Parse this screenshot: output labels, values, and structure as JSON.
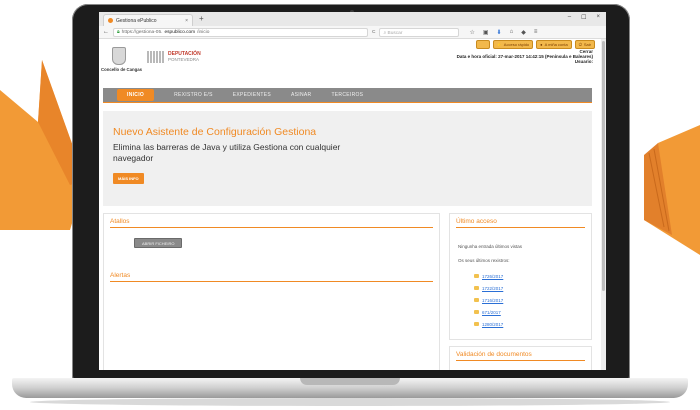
{
  "colors": {
    "accent": "#f08a24",
    "navbar": "#8a8a8a",
    "link": "#2a6fd6",
    "banner_bg": "#f0f0f0"
  },
  "browser": {
    "tab_title": "Gestiona ePublico",
    "tab_close": "×",
    "new_tab": "+",
    "window_controls": [
      "–",
      "☐",
      "×"
    ],
    "url_prefix": "https://gestiona-05.",
    "url_domain": "espublico.com",
    "url_path": "/inicio",
    "search_placeholder": "Buscar",
    "toolbar_icons": [
      "star-icon",
      "bookmark-icon",
      "download-icon",
      "home-icon",
      "shield-icon",
      "menu-icon"
    ]
  },
  "header": {
    "crest_label": "Concello de Cangas",
    "dep_line1": "DEPUTACIÓN",
    "dep_line2": "PONTEVEDRA",
    "buttons": [
      "",
      "Acceso rápido",
      "A miña conta",
      "Sair"
    ],
    "info_lines": [
      "Cerrar",
      "Data e hora oficial: 27-mar-2017 14:42:15 (Península e Baleares)",
      "Usuario:"
    ]
  },
  "nav": {
    "items": [
      "INICIO",
      "REXISTRO E/S",
      "EXPEDIENTES",
      "ASINAR",
      "TERCEIROS"
    ]
  },
  "banner": {
    "title": "Nuevo Asistente de Configuración Gestiona",
    "text": "Elimina las barreras de Java y utiliza Gestiona con cualquier navegador",
    "button": "MÁIS INFO"
  },
  "atallos": {
    "title": "Atallos",
    "button": "ABRIR FICHEIRO"
  },
  "alertas": {
    "title": "Alertas"
  },
  "ultimo_acceso": {
    "title": "Último acceso",
    "no_entries": "Ningunha entrada últimos vistas",
    "subtitle": "Os seus últimos rexistros:",
    "items": [
      "1726/2017",
      "1722/2017",
      "1716/2017",
      "671/2017",
      "1280/2017"
    ]
  },
  "validacion": {
    "title": "Validación de documentos"
  }
}
